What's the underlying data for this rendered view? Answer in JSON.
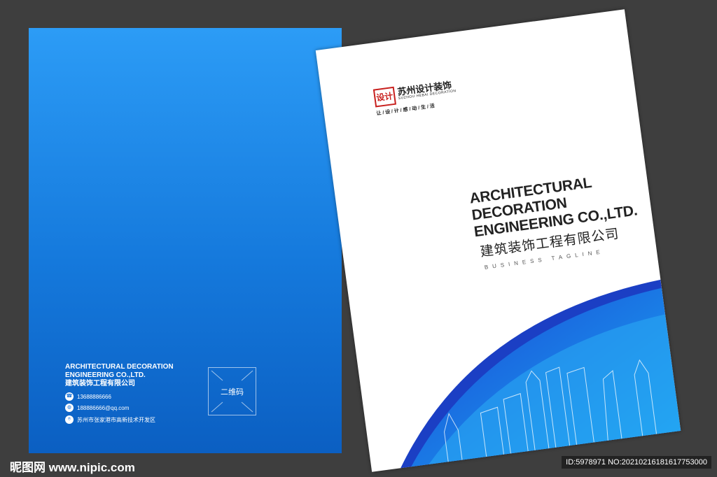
{
  "back_cover": {
    "title_en_1": "ARCHITECTURAL DECORATION",
    "title_en_2": "ENGINEERING CO.,LTD.",
    "title_cn": "建筑装饰工程有限公司",
    "phone": "13688886666",
    "email": "188886666@qq.com",
    "address": "苏州市张家港市高新技术开发区",
    "qr_label": "二维码"
  },
  "front_cover": {
    "logo_text": "设计",
    "brand_cn": "苏州设计装饰",
    "brand_en": "SUZHOU HEBAI DECORATION",
    "slogan": "让 / 设 / 计 / 感 / 动 / 生 / 活",
    "title_lines": [
      "ARCHITECTURAL",
      "DECORATION",
      "ENGINEERING CO.,LTD."
    ],
    "title_cn": "建筑装饰工程有限公司",
    "tagline": "BUSINESS TAGLINE"
  },
  "watermark": "昵图网 www.nipic.com",
  "image_id": "ID:5978971 NO:20210216181617753000",
  "colors": {
    "blue_top": "#2c9cf6",
    "blue_bottom": "#0b5fc2",
    "logo_red": "#c8201e"
  }
}
